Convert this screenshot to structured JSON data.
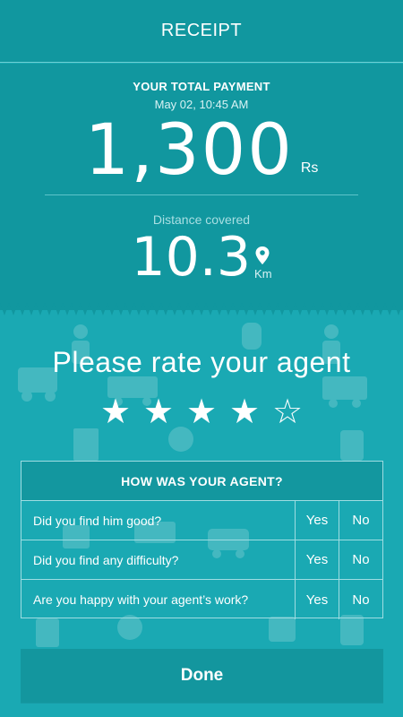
{
  "header": {
    "title": "RECEIPT"
  },
  "payment": {
    "label": "YOUR TOTAL PAYMENT",
    "date": "May 02, 10:45 AM",
    "amount": "1,300",
    "currency": "Rs"
  },
  "distance": {
    "label": "Distance covered",
    "value": "10.3",
    "unit": "Km",
    "icon": "location-pin-icon"
  },
  "rating": {
    "title": "Please rate your agent",
    "max": 5,
    "value": 4,
    "filled_glyph": "★",
    "empty_glyph": "☆"
  },
  "survey": {
    "title": "HOW WAS YOUR AGENT?",
    "yes_label": "Yes",
    "no_label": "No",
    "questions": [
      "Did you find him good?",
      "Did you find any difficulty?",
      "Are you happy with your agent’s work?"
    ]
  },
  "actions": {
    "done_label": "Done"
  },
  "colors": {
    "background": "#1aa9b3",
    "header": "#11979f",
    "text": "#ffffff"
  }
}
